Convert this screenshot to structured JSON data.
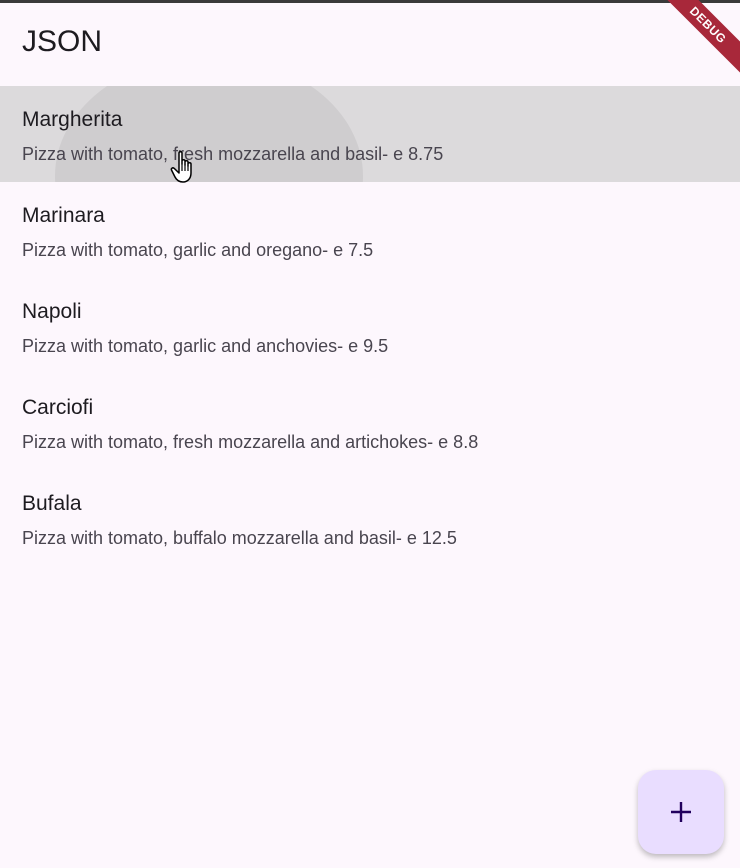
{
  "app_bar": {
    "title": "JSON"
  },
  "debug_banner": {
    "label": "DEBUG"
  },
  "pizzas": [
    {
      "name": "Margherita",
      "description": "Pizza with tomato, fresh mozzarella and basil- e 8.75"
    },
    {
      "name": "Marinara",
      "description": "Pizza with tomato, garlic and oregano- e 7.5"
    },
    {
      "name": "Napoli",
      "description": "Pizza with tomato, garlic and anchovies- e 9.5"
    },
    {
      "name": "Carciofi",
      "description": "Pizza with tomato, fresh mozzarella and artichokes- e 8.8"
    },
    {
      "name": "Bufala",
      "description": "Pizza with tomato, buffalo mozzarella and basil- e 12.5"
    }
  ],
  "fab": {
    "icon": "plus-icon"
  },
  "colors": {
    "background": "#fdf7fd",
    "fab": "#e9ddff",
    "fab_icon": "#21005d",
    "debug_banner": "#a8283a",
    "highlight": "#dcdadc"
  }
}
